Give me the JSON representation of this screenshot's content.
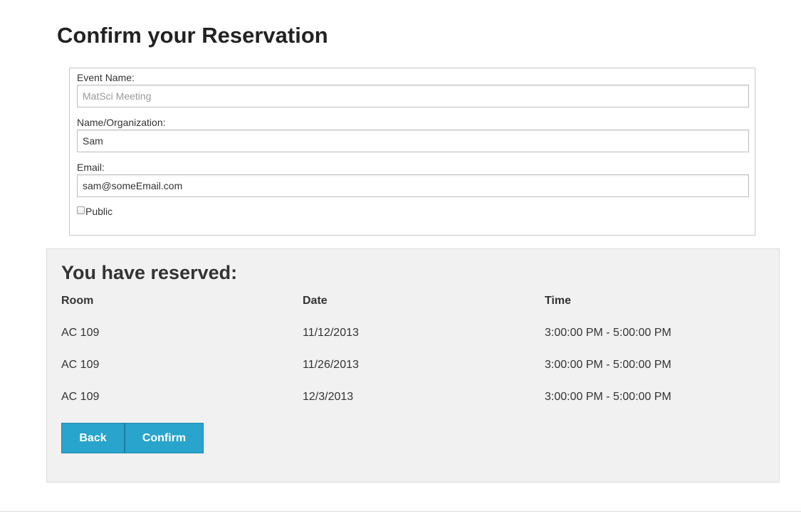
{
  "page": {
    "title": "Confirm your Reservation"
  },
  "form": {
    "event_name": {
      "label": "Event Name:",
      "placeholder": "MatSci Meeting",
      "value": ""
    },
    "organization": {
      "label": "Name/Organization:",
      "value": "Sam"
    },
    "email": {
      "label": "Email:",
      "value": "sam@someEmail.com"
    },
    "public_checkbox": {
      "label": "Public",
      "checked": false
    }
  },
  "summary": {
    "title": "You have reserved:",
    "columns": [
      "Room",
      "Date",
      "Time"
    ],
    "rows": [
      {
        "room": "AC 109",
        "date": "11/12/2013",
        "time": "3:00:00 PM - 5:00:00 PM"
      },
      {
        "room": "AC 109",
        "date": "11/26/2013",
        "time": "3:00:00 PM - 5:00:00 PM"
      },
      {
        "room": "AC 109",
        "date": "12/3/2013",
        "time": "3:00:00 PM - 5:00:00 PM"
      }
    ]
  },
  "buttons": {
    "back_label": "Back",
    "confirm_label": "Confirm"
  },
  "colors": {
    "button_bg": "#29a4cc",
    "summary_bg": "#f1f1f1"
  }
}
